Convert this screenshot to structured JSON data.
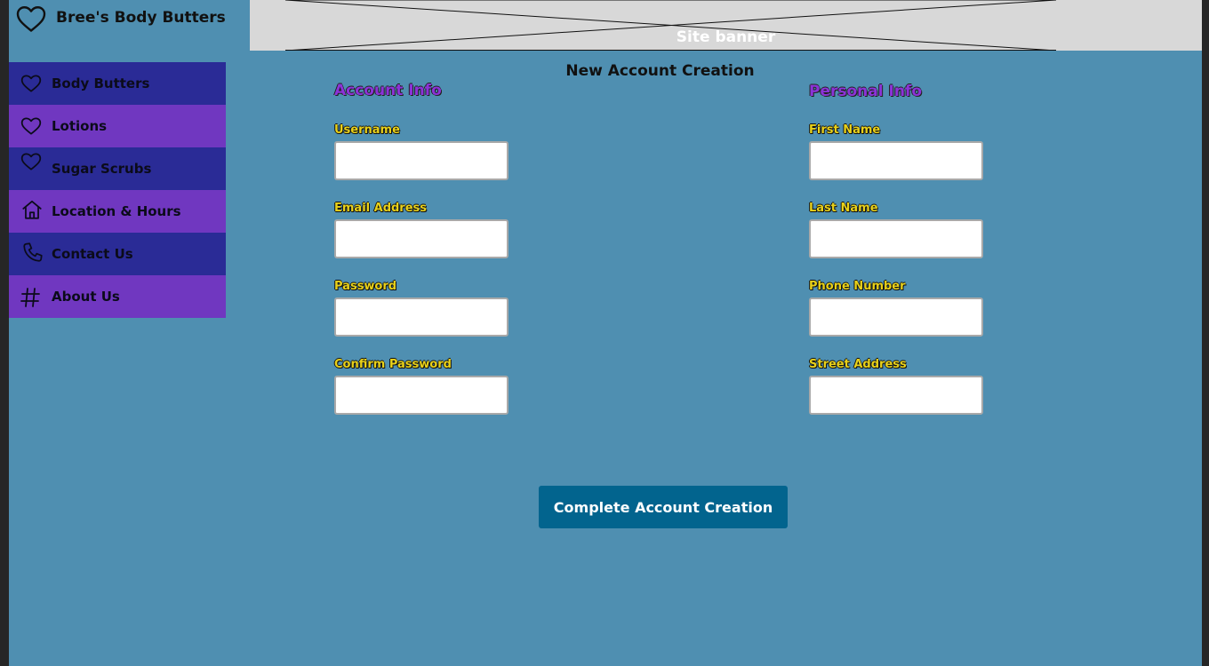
{
  "brand": {
    "name": "Bree's Body Butters",
    "icon": "heart-icon"
  },
  "banner": {
    "label": "Site banner"
  },
  "nav": {
    "items": [
      {
        "label": "Body Butters",
        "icon": "heart-icon"
      },
      {
        "label": "Lotions",
        "icon": "heart-icon"
      },
      {
        "label": "Sugar Scrubs",
        "icon": "heart-icon"
      },
      {
        "label": "Location & Hours",
        "icon": "home-icon"
      },
      {
        "label": "Contact Us",
        "icon": "phone-icon"
      },
      {
        "label": "About Us",
        "icon": "hash-icon"
      }
    ]
  },
  "form": {
    "title": "New Account Creation",
    "account": {
      "title": "Account Info",
      "fields": [
        {
          "label": "Username",
          "value": ""
        },
        {
          "label": "Email Address",
          "value": ""
        },
        {
          "label": "Password",
          "value": ""
        },
        {
          "label": "Confirm Password",
          "value": ""
        }
      ]
    },
    "personal": {
      "title": "Personal Info",
      "fields": [
        {
          "label": "First Name",
          "value": ""
        },
        {
          "label": "Last Name",
          "value": ""
        },
        {
          "label": "Phone Number",
          "value": ""
        },
        {
          "label": "Street Address",
          "value": ""
        }
      ]
    },
    "submit_label": "Complete Account Creation"
  },
  "colors": {
    "page_bg": "#4f8fb1",
    "nav_dark": "#2a2b96",
    "nav_light": "#7037c0",
    "section_title": "#8c33d8",
    "field_label": "#e8d11a",
    "button_bg": "#02648e",
    "banner_bg": "#d8d8d8"
  }
}
